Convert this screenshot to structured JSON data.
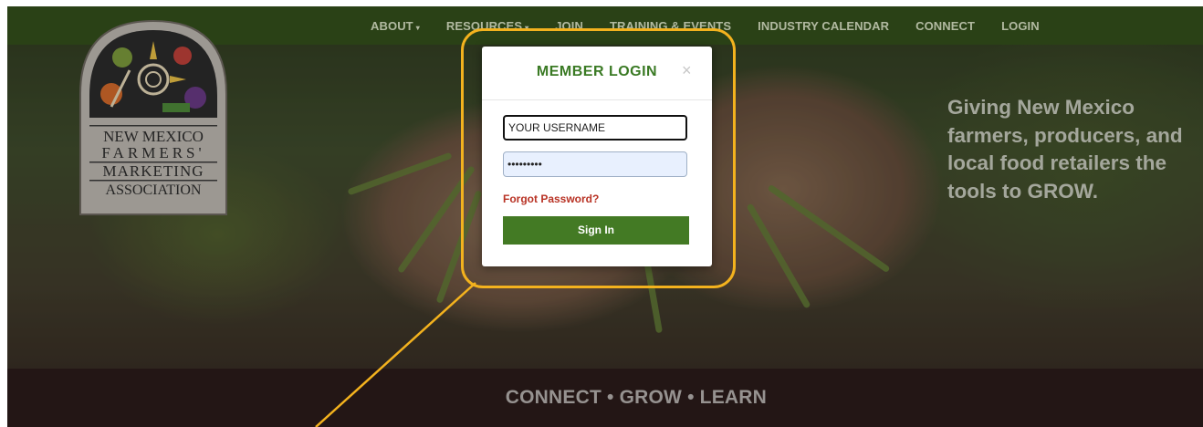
{
  "nav": {
    "items": [
      {
        "label": "ABOUT",
        "dropdown": true
      },
      {
        "label": "RESOURCES",
        "dropdown": true
      },
      {
        "label": "JOIN",
        "dropdown": false
      },
      {
        "label": "TRAINING & EVENTS",
        "dropdown": false
      },
      {
        "label": "INDUSTRY CALENDAR",
        "dropdown": false
      },
      {
        "label": "CONNECT",
        "dropdown": false
      },
      {
        "label": "LOGIN",
        "dropdown": false
      }
    ],
    "caret": "▾"
  },
  "logo": {
    "line1": "NEW MEXICO",
    "line2": "FARMERS'",
    "line3": "MARKETING",
    "line4": "ASSOCIATION"
  },
  "hero": {
    "tagline": "Giving New Mexico farmers, producers, and local food retailers the tools to GROW."
  },
  "footer": {
    "text": "CONNECT • GROW • LEARN"
  },
  "modal": {
    "title": "MEMBER LOGIN",
    "close": "×",
    "username_value": "YOUR USERNAME",
    "password_value": "•••••••••",
    "forgot_label": "Forgot Password?",
    "signin_label": "Sign In"
  },
  "colors": {
    "nav_bg": "#34501c",
    "accent_green": "#437a24",
    "title_green": "#3a7a24",
    "link_red": "#b83224",
    "highlight_gold": "#f3b21e",
    "footer_bg": "#2b1c1a"
  }
}
